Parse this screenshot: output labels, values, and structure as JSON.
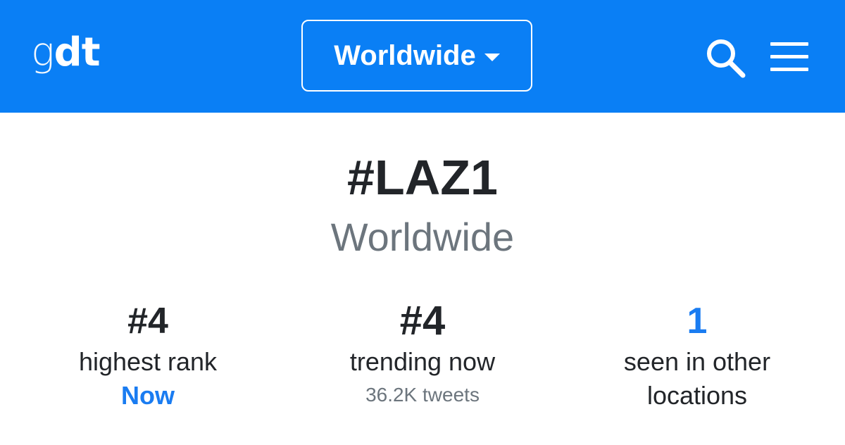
{
  "header": {
    "logo_g": "g",
    "logo_dt": "dt",
    "location_label": "Worldwide",
    "search_icon": "search-icon",
    "menu_icon": "hamburger-menu-icon",
    "bg_color": "#0a7ff5"
  },
  "trend": {
    "hashtag": "#LAZ1",
    "location": "Worldwide"
  },
  "stats": [
    {
      "value": "#4",
      "label": "highest rank",
      "sub": "Now"
    },
    {
      "value": "#4",
      "label": "trending now",
      "sub": "36.2K tweets"
    },
    {
      "value": "1",
      "label_line1": "seen in other",
      "label_line2": "locations"
    }
  ],
  "colors": {
    "accent": "#1a7cf1",
    "text": "#222529",
    "muted": "#6c757d"
  }
}
